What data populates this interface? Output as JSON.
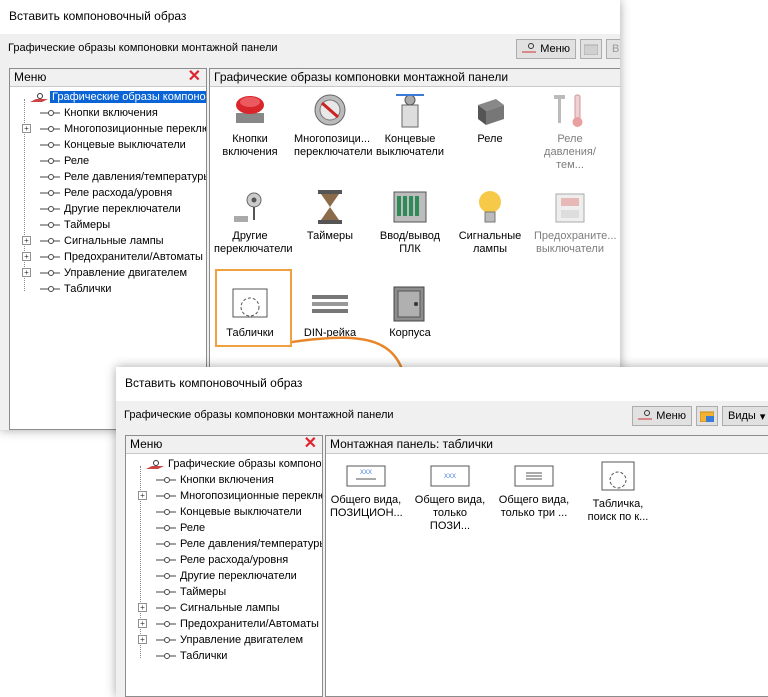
{
  "dialog1": {
    "title": "Вставить компоновочный образ",
    "subtitle": "Графические образы компоновки монтажной панели",
    "menu_button": "Меню",
    "views_button": "Ви",
    "menu_pane_title": "Меню",
    "content_title": "Графические образы компоновки монтажной панели",
    "tree": [
      {
        "label": "Графические образы компоновки",
        "root": true,
        "selected": true
      },
      {
        "label": "Кнопки включения",
        "expandable": false
      },
      {
        "label": "Многопозиционные переключатели",
        "expandable": true
      },
      {
        "label": "Концевые выключатели",
        "expandable": false
      },
      {
        "label": "Реле",
        "expandable": false
      },
      {
        "label": "Реле давления/температуры",
        "expandable": false
      },
      {
        "label": "Реле расхода/уровня",
        "expandable": false
      },
      {
        "label": "Другие переключатели",
        "expandable": false
      },
      {
        "label": "Таймеры",
        "expandable": false
      },
      {
        "label": "Сигнальные лампы",
        "expandable": true
      },
      {
        "label": "Предохранители/Автоматы",
        "expandable": true
      },
      {
        "label": "Управление двигателем",
        "expandable": true
      },
      {
        "label": "Таблички",
        "expandable": false
      }
    ],
    "items": [
      {
        "line1": "Кнопки",
        "line2": "включения",
        "icon": "push-button-icon"
      },
      {
        "line1": "Многопозици...",
        "line2": "переключатели",
        "icon": "selector-switch-icon"
      },
      {
        "line1": "Концевые",
        "line2": "выключатели",
        "icon": "limit-switch-icon"
      },
      {
        "line1": "Реле",
        "line2": "",
        "icon": "relay-icon"
      },
      {
        "line1": "Реле",
        "line2": "давления/тем...",
        "icon": "pressure-temp-relay-icon",
        "dim": true
      },
      {
        "line1": "Другие",
        "line2": "переключатели",
        "icon": "other-switch-icon"
      },
      {
        "line1": "Таймеры",
        "line2": "",
        "icon": "hourglass-icon"
      },
      {
        "line1": "Ввод/вывод",
        "line2": "ПЛК",
        "icon": "plc-io-icon"
      },
      {
        "line1": "Сигнальные",
        "line2": "лампы",
        "icon": "lamp-icon"
      },
      {
        "line1": "Предохраните...",
        "line2": "выключатели",
        "icon": "fuse-icon",
        "dim": true
      },
      {
        "line1": "Таблички",
        "line2": "",
        "icon": "nameplate-icon"
      },
      {
        "line1": "DIN-рейка",
        "line2": "",
        "icon": "din-rail-icon"
      },
      {
        "line1": "Корпуса",
        "line2": "",
        "icon": "enclosure-icon"
      }
    ]
  },
  "dialog2": {
    "title": "Вставить компоновочный образ",
    "subtitle": "Графические образы компоновки монтажной панели",
    "menu_button": "Меню",
    "views_button": "Виды",
    "menu_pane_title": "Меню",
    "content_title": "Монтажная панель: таблички",
    "tree": [
      {
        "label": "Графические образы компоновки",
        "root": true,
        "selected": false
      },
      {
        "label": "Кнопки включения",
        "expandable": false
      },
      {
        "label": "Многопозиционные переключатели",
        "expandable": true
      },
      {
        "label": "Концевые выключатели",
        "expandable": false
      },
      {
        "label": "Реле",
        "expandable": false
      },
      {
        "label": "Реле давления/температуры",
        "expandable": false
      },
      {
        "label": "Реле расхода/уровня",
        "expandable": false
      },
      {
        "label": "Другие переключатели",
        "expandable": false
      },
      {
        "label": "Таймеры",
        "expandable": false
      },
      {
        "label": "Сигнальные лампы",
        "expandable": true
      },
      {
        "label": "Предохранители/Автоматы",
        "expandable": true
      },
      {
        "label": "Управление двигателем",
        "expandable": true
      },
      {
        "label": "Таблички",
        "expandable": false
      }
    ],
    "items": [
      {
        "line1": "Общего вида,",
        "line2": "ПОЗИЦИОН...",
        "icon": "plate-xxx-icon"
      },
      {
        "line1": "Общего вида,",
        "line2": "только ПОЗИ...",
        "icon": "plate-xxx-small-icon"
      },
      {
        "line1": "Общего вида,",
        "line2": "только три ...",
        "icon": "plate-lines-icon"
      },
      {
        "line1": "Табличка,",
        "line2": "поиск по к...",
        "icon": "plate-round-icon"
      }
    ]
  },
  "colors": {
    "accent": "#0a64d6",
    "highlight": "#f0a040",
    "close": "#e0242f"
  }
}
